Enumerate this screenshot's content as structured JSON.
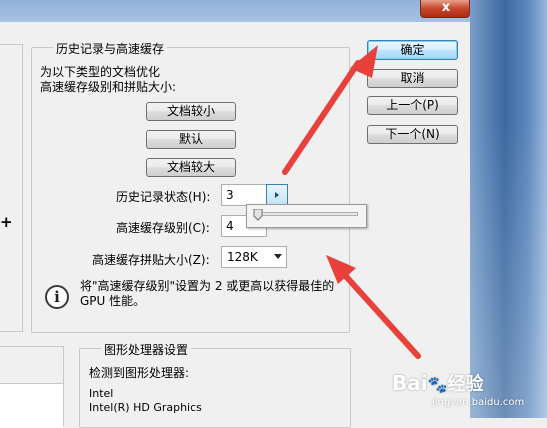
{
  "dialog": {
    "buttons": {
      "ok": "确定",
      "cancel": "取消",
      "prev": "上一个(P)",
      "next": "下一个(N)"
    }
  },
  "history_cache": {
    "legend": "历史记录与高速缓存",
    "optimize_line1": "为以下类型的文档优化",
    "optimize_line2": "高速缓存级别和拼贴大小:",
    "preset_small": "文档较小",
    "preset_default": "默认",
    "preset_large": "文档较大",
    "history_states_label": "历史记录状态(H):",
    "history_states_value": "3",
    "cache_levels_label": "高速缓存级别(C):",
    "cache_levels_value": "4",
    "tile_size_label": "高速缓存拼贴大小(Z):",
    "tile_size_value": "128K",
    "info_line1": "将\"高速缓存级别\"设置为 2 或更高以获得最佳的",
    "info_line2": "GPU 性能。"
  },
  "gpu_settings": {
    "legend": "图形处理器设置",
    "detected_label": "检测到图形处理器:",
    "vendor": "Intel",
    "model": "Intel(R) HD Graphics"
  },
  "left_panel": {
    "plus_glyph": "+"
  },
  "window": {
    "close_glyph": "x"
  },
  "watermark": {
    "text": "Bai",
    "paw": "🐾",
    "text2": "经验",
    "sub": "jingyan.baidu.com"
  },
  "annotation": {
    "arrow_color": "#e8403a"
  }
}
